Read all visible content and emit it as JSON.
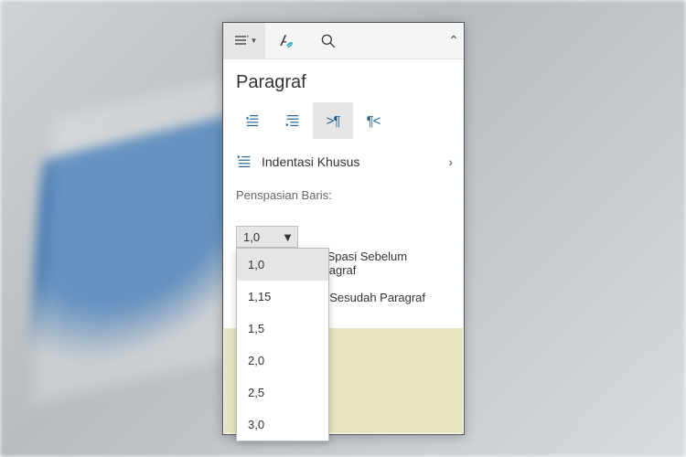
{
  "title": "Paragraf",
  "toolbar": {
    "paragraph_btn": "paragraph",
    "font_btn": "font-format",
    "search_btn": "search"
  },
  "align": {
    "decrease": "decrease-indent",
    "increase": "increase-indent",
    "ltr": ">¶",
    "rtl": "¶<"
  },
  "indent_row": {
    "label": "Indentasi Khusus"
  },
  "spacing": {
    "label": "Penspasian Baris:",
    "value": "1,0",
    "options": [
      "1,0",
      "1,15",
      "1,5",
      "2,0",
      "2,5",
      "3,0"
    ]
  },
  "checks": {
    "before": "Tambahkan Spasi Sebelum Paragraf",
    "before_partial": "an Spasi Sebelum Paragraf",
    "after": "Tambahkan Spasi Sesudah Paragraf",
    "after_partial": "asi Sesudah Paragraf"
  }
}
